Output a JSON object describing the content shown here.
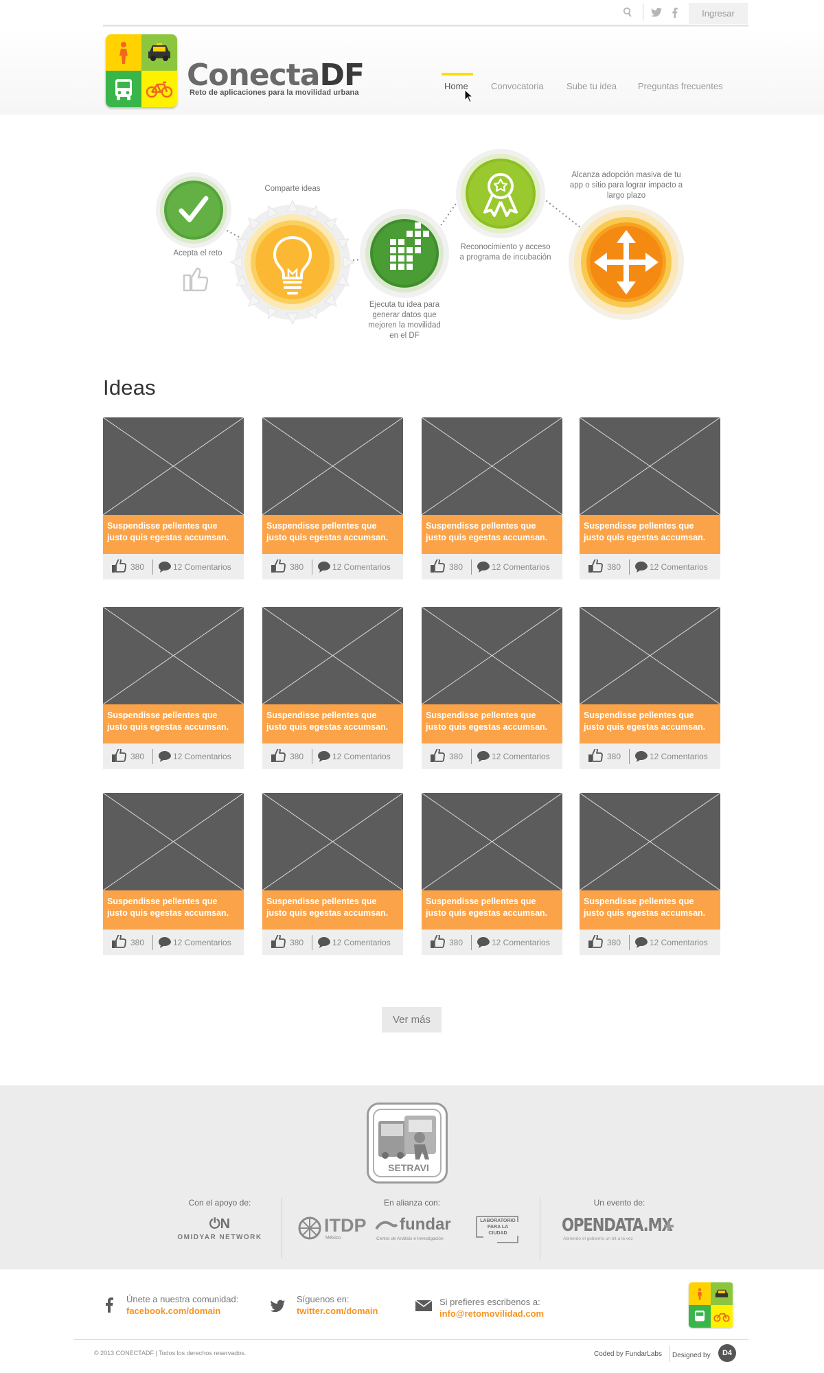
{
  "topbar": {
    "login_label": "Ingresar",
    "icons": [
      "search-icon",
      "twitter-icon",
      "facebook-icon"
    ]
  },
  "brand": {
    "name_part1": "Conecta",
    "name_part2": "DF",
    "tagline": "Reto de aplicaciones para la movilidad urbana",
    "colors": {
      "yellow": "#ffdd00",
      "green": "#55b231",
      "orange": "#f7931e"
    }
  },
  "nav": {
    "items": [
      "Home",
      "Convocatoria",
      "Sube tu idea",
      "Preguntas frecuentes"
    ],
    "active_index": 0
  },
  "steps": [
    {
      "label": "Acepta el reto",
      "icon": "checkmark-icon"
    },
    {
      "label": "Comparte ideas",
      "icon": "lightbulb-icon"
    },
    {
      "label": "Ejecuta tu idea para generar datos que mejoren la movilidad en el DF",
      "icon": "data-grid-icon"
    },
    {
      "label": "Reconocimiento y acceso a programa de incubación",
      "icon": "award-ribbon-icon"
    },
    {
      "label": "Alcanza adopción masiva de tu app o sitio para lograr impacto a largo plazo",
      "icon": "expand-arrows-icon"
    }
  ],
  "ideas": {
    "title": "Ideas",
    "cards": [
      {
        "title": "Suspendisse pellentes que justo quis egestas accumsan.",
        "likes": "380",
        "comments": "12 Comentarios"
      },
      {
        "title": "Suspendisse pellentes que justo quis egestas accumsan.",
        "likes": "380",
        "comments": "12 Comentarios"
      },
      {
        "title": "Suspendisse pellentes que justo quis egestas accumsan.",
        "likes": "380",
        "comments": "12 Comentarios"
      },
      {
        "title": "Suspendisse pellentes que justo quis egestas accumsan.",
        "likes": "380",
        "comments": "12 Comentarios"
      },
      {
        "title": "Suspendisse pellentes que justo quis egestas accumsan.",
        "likes": "380",
        "comments": "12 Comentarios"
      },
      {
        "title": "Suspendisse pellentes que justo quis egestas accumsan.",
        "likes": "380",
        "comments": "12 Comentarios"
      },
      {
        "title": "Suspendisse pellentes que justo quis egestas accumsan.",
        "likes": "380",
        "comments": "12 Comentarios"
      },
      {
        "title": "Suspendisse pellentes que justo quis egestas accumsan.",
        "likes": "380",
        "comments": "12 Comentarios"
      },
      {
        "title": "Suspendisse pellentes que justo quis egestas accumsan.",
        "likes": "380",
        "comments": "12 Comentarios"
      },
      {
        "title": "Suspendisse pellentes que justo quis egestas accumsan.",
        "likes": "380",
        "comments": "12 Comentarios"
      },
      {
        "title": "Suspendisse pellentes que justo quis egestas accumsan.",
        "likes": "380",
        "comments": "12 Comentarios"
      },
      {
        "title": "Suspendisse pellentes que justo quis egestas accumsan.",
        "likes": "380",
        "comments": "12 Comentarios"
      }
    ],
    "more_label": "Ver más",
    "card_accent": "#fba349"
  },
  "sponsors": {
    "setravi_label": "SETRAVI",
    "support_caption": "Con el apoyo de:",
    "omidyar_mark": "⏻N",
    "omidyar_name": "OMIDYAR NETWORK",
    "alliance_caption": "En alianza con:",
    "itdp_name": "ITDP",
    "itdp_sub": "México",
    "fundar_name": "fundar",
    "fundar_sub": "Centro de Análisis e Investigación",
    "lab_lines": [
      "LABORATORIO",
      "PARA LA",
      "CIUDAD"
    ],
    "event_caption": "Un evento de:",
    "opendata_name": "OPENDATA.MX",
    "opendata_sub": "Abriendo el gobierno un bit a la vez"
  },
  "community": {
    "facebook_label": "Únete a nuestra comunidad:",
    "facebook_link": "facebook.com/domain",
    "twitter_label": "Síguenos en:",
    "twitter_link": "twitter.com/domain",
    "email_label": "Si prefieres escribenos a:",
    "email_link": "info@retomovilidad.com"
  },
  "footer": {
    "copyright": "© 2013 CONECTADF | Todos los derechos reservados.",
    "coded_by": "Coded by FundarLabs",
    "designed_by": "Designed by",
    "designer_badge": "D4"
  }
}
